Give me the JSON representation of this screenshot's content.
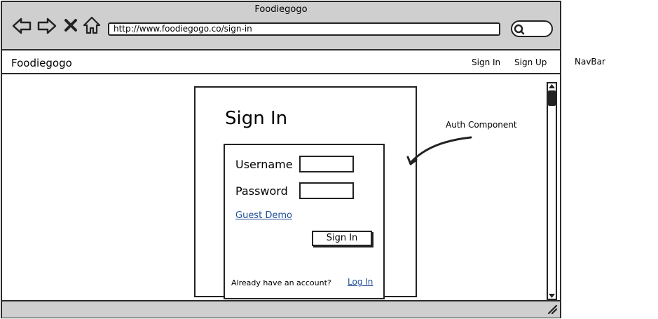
{
  "window": {
    "title": "Foodiegogo",
    "url": "http://www.foodiegogo.co/sign-in"
  },
  "navbar": {
    "brand": "Foodiegogo",
    "links": {
      "signin": "Sign In",
      "signup": "Sign Up"
    },
    "annotation": "NavBar"
  },
  "auth": {
    "title": "Sign In",
    "username_label": "Username",
    "password_label": "Password",
    "guest_demo": "Guest Demo",
    "submit_label": "Sign In",
    "footer_text": "Already have an account?",
    "login_link": "Log In",
    "annotation": "Auth Component"
  },
  "icons": {
    "back": "back-arrow-icon",
    "forward": "forward-arrow-icon",
    "stop": "close-icon",
    "home": "home-icon",
    "search": "search-icon",
    "resize": "resize-grip-icon"
  },
  "colors": {
    "link": "#1f4e96",
    "chrome": "#cfcfcf",
    "stroke": "#222222"
  }
}
